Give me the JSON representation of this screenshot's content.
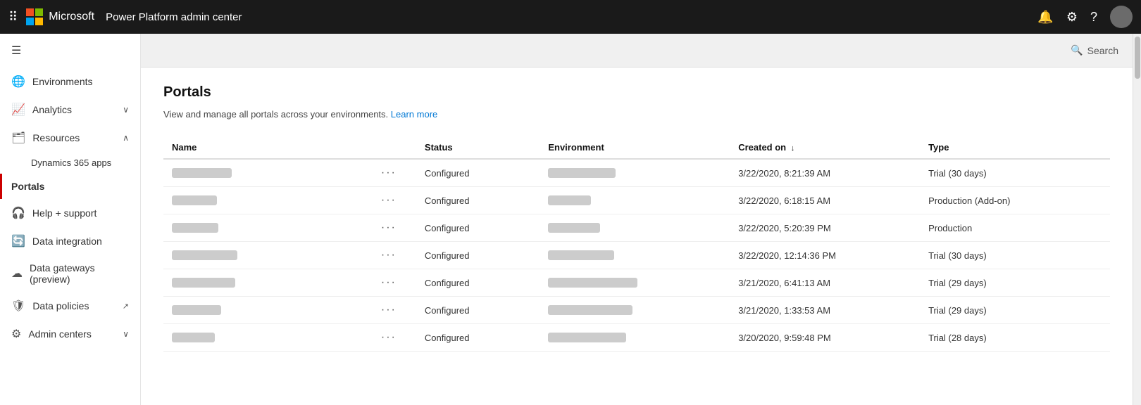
{
  "topbar": {
    "app_name": "Power Platform admin center",
    "search_label": "Search",
    "icons": {
      "grid": "⊞",
      "bell": "🔔",
      "settings": "⚙",
      "help": "?"
    }
  },
  "sidebar": {
    "hamburger_label": "☰",
    "items": [
      {
        "id": "environments",
        "label": "Environments",
        "icon": "🌐",
        "has_chevron": false
      },
      {
        "id": "analytics",
        "label": "Analytics",
        "icon": "📈",
        "has_chevron": true,
        "chevron": "∨"
      },
      {
        "id": "resources",
        "label": "Resources",
        "icon": "🗂",
        "has_chevron": true,
        "chevron": "∧"
      },
      {
        "id": "dynamics365",
        "label": "Dynamics 365 apps",
        "icon": "",
        "is_subitem": true
      },
      {
        "id": "portals",
        "label": "Portals",
        "icon": "",
        "is_subitem": true,
        "active": true
      },
      {
        "id": "help_support",
        "label": "Help + support",
        "icon": "🎧",
        "has_chevron": false
      },
      {
        "id": "data_integration",
        "label": "Data integration",
        "icon": "🔄",
        "has_chevron": false
      },
      {
        "id": "data_gateways",
        "label": "Data gateways (preview)",
        "icon": "☁",
        "has_chevron": false
      },
      {
        "id": "data_policies",
        "label": "Data policies",
        "icon": "🛡",
        "has_chevron": false,
        "external_icon": true
      },
      {
        "id": "admin_centers",
        "label": "Admin centers",
        "icon": "⚙",
        "has_chevron": true,
        "chevron": "∨"
      }
    ]
  },
  "page": {
    "title": "Portals",
    "subtitle": "View and manage all portals across your environments.",
    "learn_more_label": "Learn more"
  },
  "table": {
    "columns": [
      {
        "id": "name",
        "label": "Name"
      },
      {
        "id": "dots",
        "label": ""
      },
      {
        "id": "status",
        "label": "Status"
      },
      {
        "id": "environment",
        "label": "Environment"
      },
      {
        "id": "created_on",
        "label": "Created on",
        "sort": "↓"
      },
      {
        "id": "type",
        "label": "Type"
      }
    ],
    "rows": [
      {
        "name": "██████████",
        "status": "Configured",
        "environment": "████████████",
        "created_on": "3/22/2020, 8:21:39 AM",
        "type": "Trial (30 days)"
      },
      {
        "name": "█████████",
        "status": "Configured",
        "environment": "██████████",
        "created_on": "3/22/2020, 6:18:15 AM",
        "type": "Production (Add-on)"
      },
      {
        "name": "████████████",
        "status": "Configured",
        "environment": "██████",
        "created_on": "3/22/2020, 5:20:39 PM",
        "type": "Production"
      },
      {
        "name": "█████████",
        "status": "Configured",
        "environment": "████████████",
        "created_on": "3/22/2020, 12:14:36 PM",
        "type": "Trial (30 days)"
      },
      {
        "name": "████████",
        "status": "Configured",
        "environment": "████████████",
        "created_on": "3/21/2020, 6:41:13 AM",
        "type": "Trial (29 days)"
      },
      {
        "name": "████████████████",
        "status": "Configured",
        "environment": "██████████████",
        "created_on": "3/21/2020, 1:33:53 AM",
        "type": "Trial (29 days)"
      },
      {
        "name": "████",
        "status": "Configured",
        "environment": "██████████████████",
        "created_on": "3/20/2020, 9:59:48 PM",
        "type": "Trial (28 days)"
      }
    ]
  }
}
